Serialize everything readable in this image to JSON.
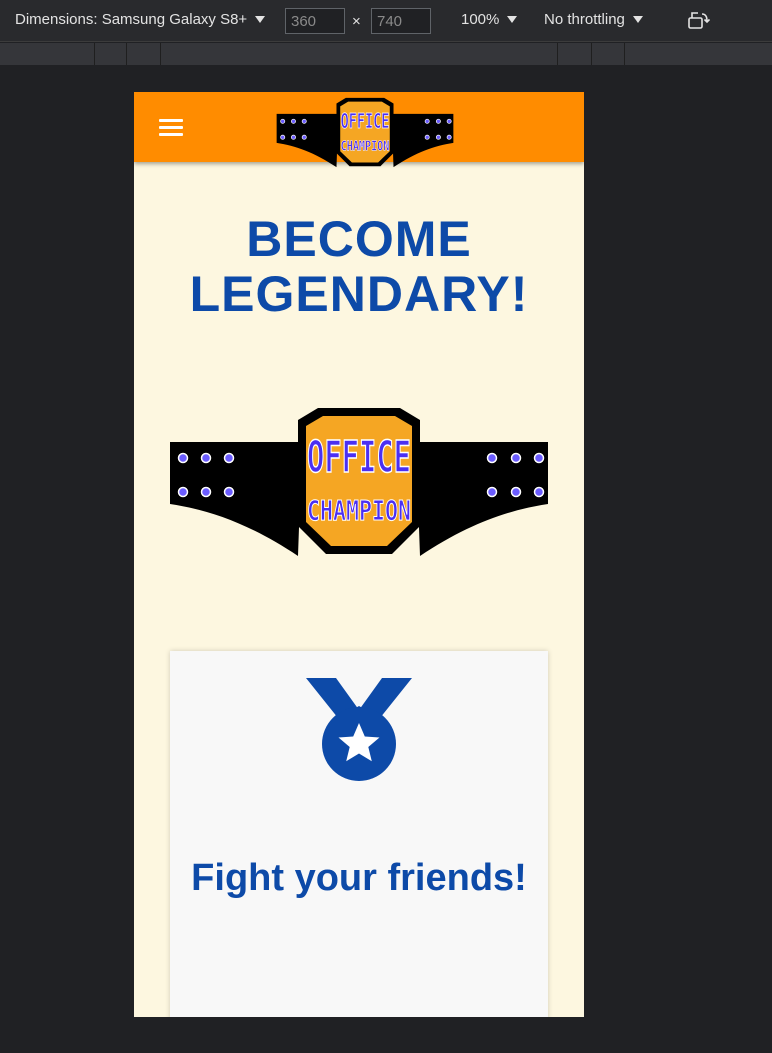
{
  "devtools": {
    "dimensions_label": "Dimensions: Samsung Galaxy S8+",
    "width_value": "360",
    "height_value": "740",
    "times_symbol": "×",
    "zoom_label": "100%",
    "throttle_label": "No throttling",
    "rotate_icon": "rotate-icon"
  },
  "site": {
    "menu_icon": "hamburger-menu-icon",
    "logo": {
      "line1": "OFFICE",
      "line2": "CHAMPION",
      "colors": {
        "belt": "#000000",
        "plate": "#f5a623",
        "text": "#4b2ff2",
        "studs": "#6b5cff"
      }
    },
    "hero_title": "BECOME LEGENDARY!",
    "feature_card": {
      "icon": "medal-icon",
      "title": "Fight your friends!"
    }
  },
  "colors": {
    "header_bg": "#ff8c00",
    "page_bg": "#fdf7e0",
    "accent_blue": "#0d4aa8",
    "card_bg": "#f8f8f8"
  }
}
